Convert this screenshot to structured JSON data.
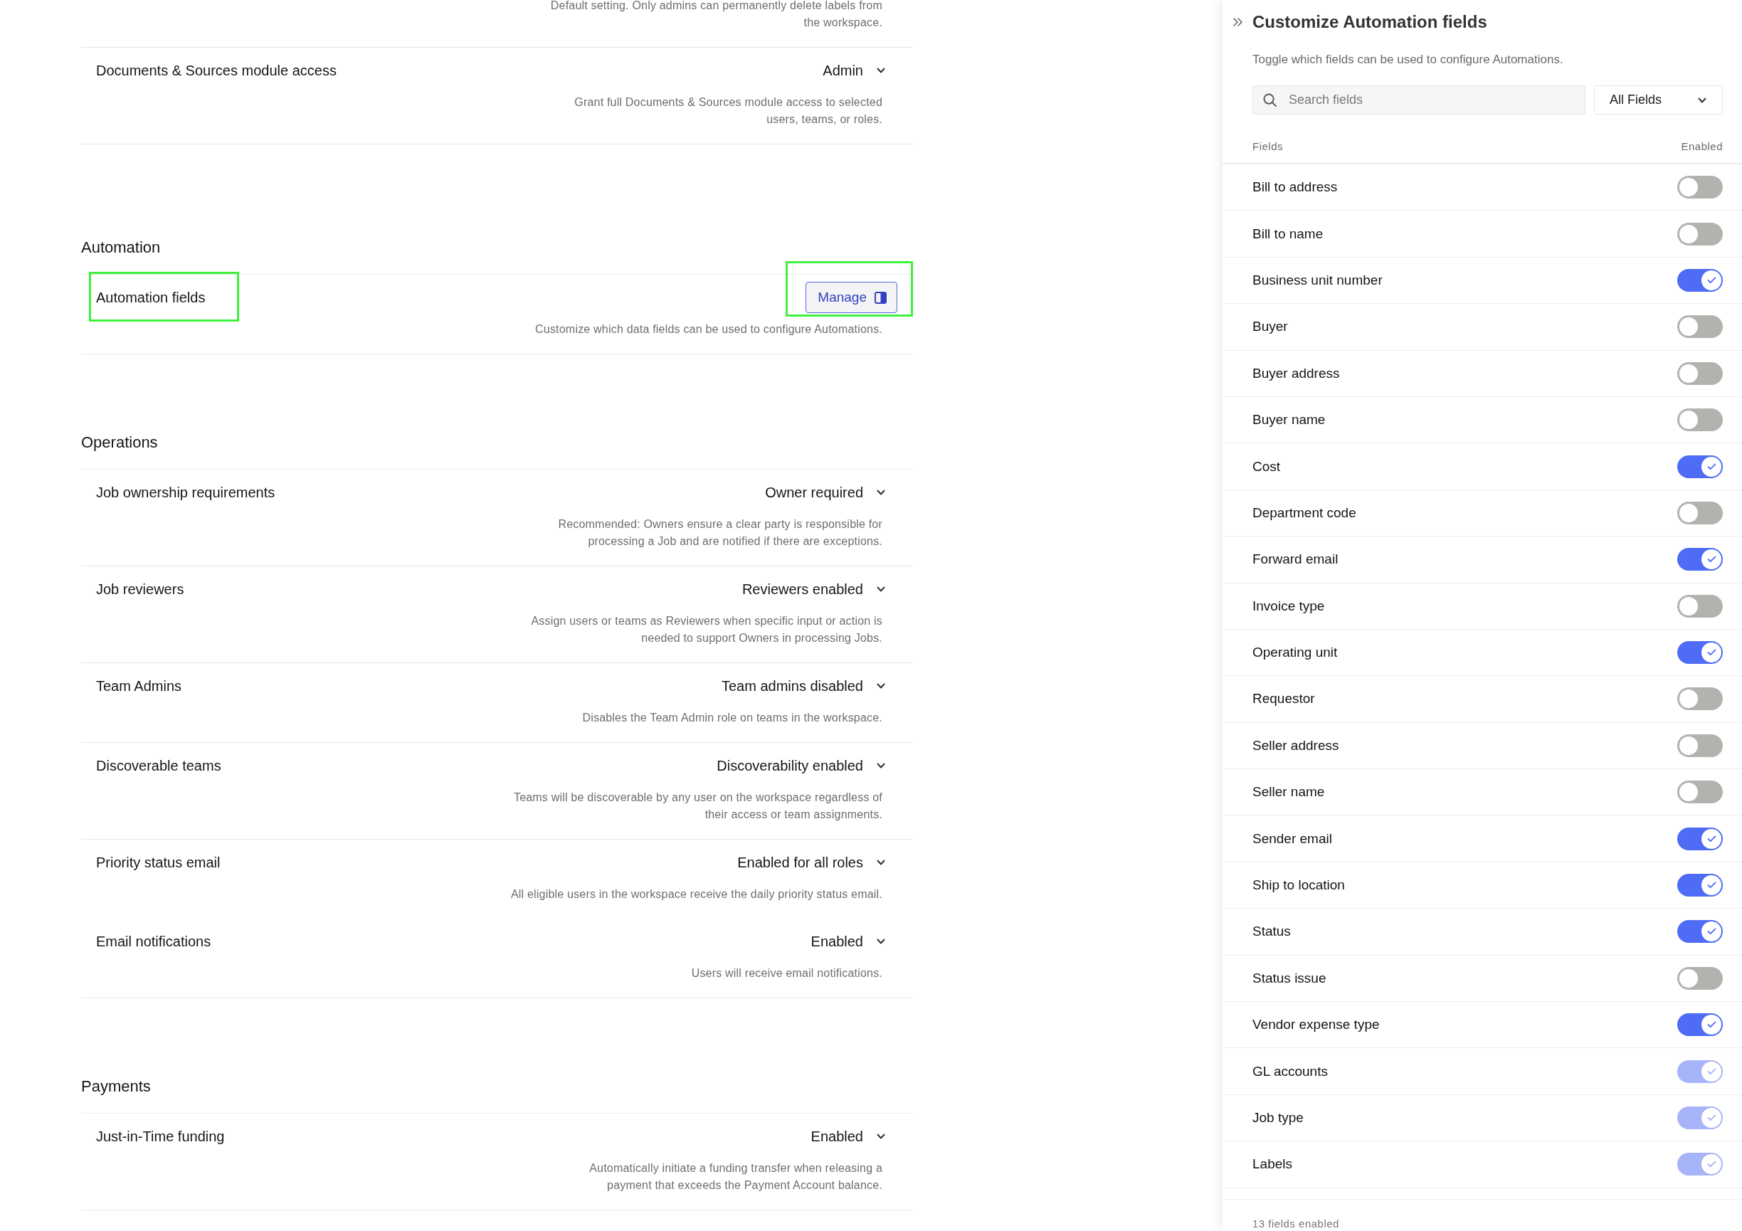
{
  "settings_page": {
    "sections": [
      {
        "settings": [
          {
            "description": "Default setting. Only admins can permanently delete labels from\nthe workspace.",
            "divider": true
          },
          {
            "label": "Documents & Sources module access",
            "highlighted": false,
            "control": {
              "kind": "dropdown",
              "value": "Admin",
              "highlighted": false
            },
            "description": "Grant full Documents & Sources module access to selected\nusers, teams, or roles.",
            "divider": true
          }
        ]
      },
      {
        "title": "Automation",
        "settings": [
          {
            "label": "Automation fields",
            "highlighted": true,
            "control": {
              "kind": "button",
              "label": "Manage",
              "highlighted": true
            },
            "description": "Customize which data fields can be used to configure Automations.",
            "divider": true
          }
        ]
      },
      {
        "title": "Operations",
        "settings": [
          {
            "label": "Job ownership requirements",
            "highlighted": false,
            "control": {
              "kind": "dropdown",
              "value": "Owner required",
              "highlighted": false
            },
            "description": "Recommended: Owners ensure a clear party is responsible for\nprocessing a Job and are notified if there are exceptions.",
            "divider": true
          },
          {
            "label": "Job reviewers",
            "highlighted": false,
            "control": {
              "kind": "dropdown",
              "value": "Reviewers enabled",
              "highlighted": false
            },
            "description": "Assign users or teams as Reviewers when specific input or action is\nneeded to support Owners in processing Jobs.",
            "divider": true
          },
          {
            "label": "Team Admins",
            "highlighted": false,
            "control": {
              "kind": "dropdown",
              "value": "Team admins disabled",
              "highlighted": false
            },
            "description": "Disables the Team Admin role on teams in the workspace.",
            "divider": true
          },
          {
            "label": "Discoverable teams",
            "highlighted": false,
            "control": {
              "kind": "dropdown",
              "value": "Discoverability enabled",
              "highlighted": false
            },
            "description": "Teams will be discoverable by any user on the workspace regardless of\ntheir access or team assignments.",
            "divider": true
          },
          {
            "label": "Priority status email",
            "highlighted": false,
            "control": {
              "kind": "dropdown",
              "value": "Enabled for all roles",
              "highlighted": false
            },
            "description": "All eligible users in the workspace receive the daily priority status email.",
            "divider": false
          },
          {
            "label": "Email notifications",
            "highlighted": false,
            "control": {
              "kind": "dropdown",
              "value": "Enabled",
              "highlighted": false
            },
            "description": "Users will receive email notifications.",
            "divider": true
          }
        ]
      },
      {
        "title": "Payments",
        "settings": [
          {
            "label": "Just-in-Time funding",
            "highlighted": false,
            "control": {
              "kind": "dropdown",
              "value": "Enabled",
              "highlighted": false
            },
            "description": "Automatically initiate a funding transfer when releasing a\npayment that exceeds the Payment Account balance.",
            "divider": true
          }
        ]
      }
    ]
  },
  "side_panel": {
    "title": "Customize Automation fields",
    "subtitle": "Toggle which fields can be used to configure Automations.",
    "search": {
      "placeholder": "Search fields"
    },
    "filter": {
      "value": "All Fields"
    },
    "columns": [
      "Fields",
      "Enabled"
    ],
    "fields": [
      {
        "name": "Bill to address",
        "on": false,
        "disabled": false
      },
      {
        "name": "Bill to name",
        "on": false,
        "disabled": false
      },
      {
        "name": "Business unit number",
        "on": true,
        "disabled": false
      },
      {
        "name": "Buyer",
        "on": false,
        "disabled": false
      },
      {
        "name": "Buyer address",
        "on": false,
        "disabled": false
      },
      {
        "name": "Buyer name",
        "on": false,
        "disabled": false
      },
      {
        "name": "Cost",
        "on": true,
        "disabled": false
      },
      {
        "name": "Department code",
        "on": false,
        "disabled": false
      },
      {
        "name": "Forward email",
        "on": true,
        "disabled": false
      },
      {
        "name": "Invoice type",
        "on": false,
        "disabled": false
      },
      {
        "name": "Operating unit",
        "on": true,
        "disabled": false
      },
      {
        "name": "Requestor",
        "on": false,
        "disabled": false
      },
      {
        "name": "Seller address",
        "on": false,
        "disabled": false
      },
      {
        "name": "Seller name",
        "on": false,
        "disabled": false
      },
      {
        "name": "Sender email",
        "on": true,
        "disabled": false
      },
      {
        "name": "Ship to location",
        "on": true,
        "disabled": false
      },
      {
        "name": "Status",
        "on": true,
        "disabled": false
      },
      {
        "name": "Status issue",
        "on": false,
        "disabled": false
      },
      {
        "name": "Vendor expense type",
        "on": true,
        "disabled": false
      },
      {
        "name": "GL accounts",
        "on": true,
        "disabled": true
      },
      {
        "name": "Job type",
        "on": true,
        "disabled": true
      },
      {
        "name": "Labels",
        "on": true,
        "disabled": true
      }
    ],
    "footer": "13 fields enabled"
  }
}
